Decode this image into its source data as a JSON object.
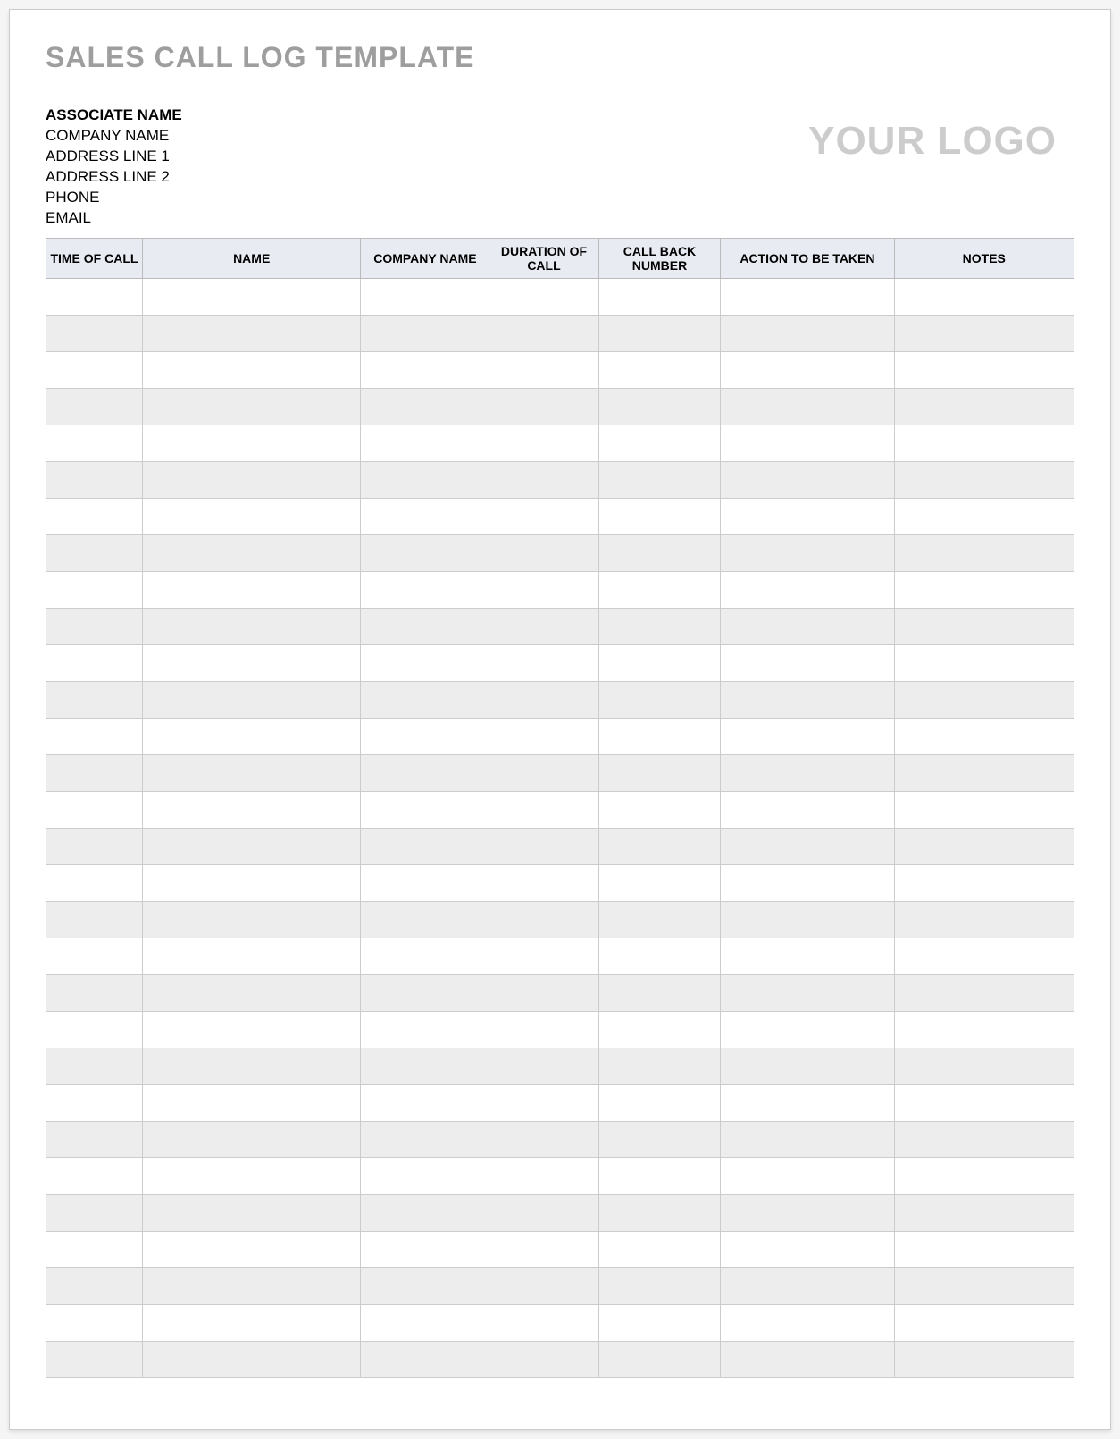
{
  "title": "SALES CALL LOG TEMPLATE",
  "associate": {
    "name_label": "ASSOCIATE NAME",
    "company_label": "COMPANY NAME",
    "address1_label": "ADDRESS LINE 1",
    "address2_label": "ADDRESS LINE 2",
    "phone_label": "PHONE",
    "email_label": "EMAIL"
  },
  "logo_placeholder": "YOUR LOGO",
  "table": {
    "headers": {
      "time_of_call": "TIME OF CALL",
      "name": "NAME",
      "company_name": "COMPANY NAME",
      "duration_of_call": "DURATION OF CALL",
      "call_back_number": "CALL BACK NUMBER",
      "action_to_be_taken": "ACTION TO BE TAKEN",
      "notes": "NOTES"
    },
    "row_count": 30
  }
}
